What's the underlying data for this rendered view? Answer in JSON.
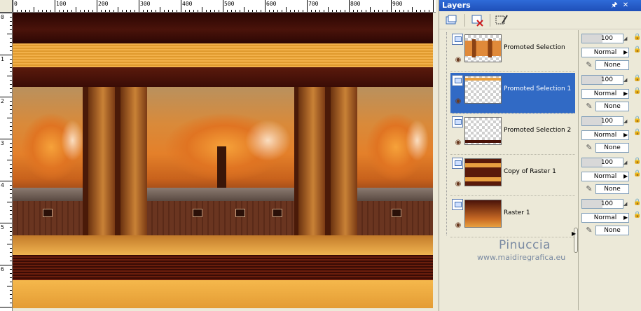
{
  "ruler": {
    "h_labels": [
      "0",
      "100",
      "200",
      "300",
      "400",
      "500",
      "600",
      "700",
      "800",
      "900"
    ],
    "v_labels": [
      "0",
      "1",
      "2",
      "3",
      "4",
      "5",
      "6"
    ]
  },
  "palette": {
    "title": "Layers",
    "pin_icon": "pin-icon",
    "close_icon": "close-icon"
  },
  "toolbar": {
    "tools": [
      "new-layer-icon",
      "delete-layer-icon",
      "edit-selection-icon"
    ]
  },
  "layers": [
    {
      "name": "Promoted Selection",
      "opacity": "100",
      "blend": "Normal",
      "mask": "None",
      "selected": false
    },
    {
      "name": "Promoted Selection 1",
      "opacity": "100",
      "blend": "Normal",
      "mask": "None",
      "selected": true
    },
    {
      "name": "Promoted Selection 2",
      "opacity": "100",
      "blend": "Normal",
      "mask": "None",
      "selected": false
    },
    {
      "name": "Copy of Raster 1",
      "opacity": "100",
      "blend": "Normal",
      "mask": "None",
      "selected": false
    },
    {
      "name": "Raster 1",
      "opacity": "100",
      "blend": "Normal",
      "mask": "None",
      "selected": false
    }
  ],
  "watermark": {
    "name": "Pinuccia",
    "url": "www.maidiregrafica.eu"
  },
  "colors": {
    "selection": "#316ac5",
    "titlebar": "#2f6bd8",
    "panel_bg": "#ece9d8"
  }
}
